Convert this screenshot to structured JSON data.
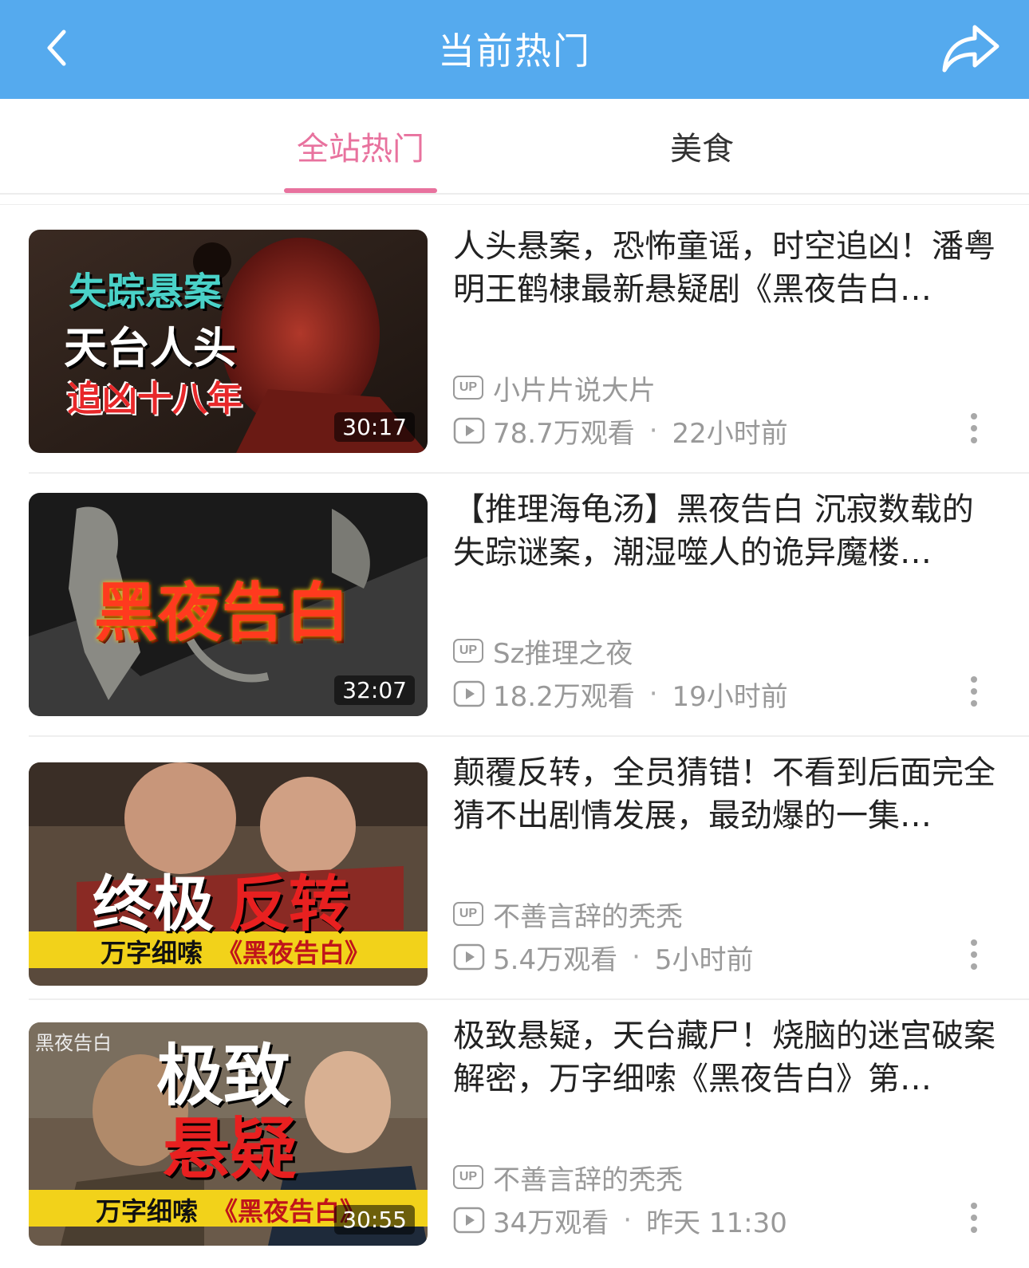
{
  "header": {
    "title": "当前热门",
    "back_icon": "chevron-left-icon",
    "share_icon": "share-icon",
    "bg_color": "#55aaee"
  },
  "tabs": [
    {
      "label": "全站热门",
      "active": true
    },
    {
      "label": "美食",
      "active": false
    }
  ],
  "accent_color": "#e8729e",
  "videos": [
    {
      "title": "人头悬案，恐怖童谣，时空追凶！潘粤明王鹤棣最新悬疑剧《黑夜告白…",
      "uploader": "小片片说大片",
      "views": "78.7万观看",
      "time": "22小时前",
      "duration": "30:17",
      "thumb_text": [
        "失踪悬案",
        "天台人头",
        "追凶十八年"
      ]
    },
    {
      "title": "【推理海龟汤】黑夜告白  沉寂数载的失踪谜案，潮湿噬人的诡异魔楼…",
      "uploader": "Sz推理之夜",
      "views": "18.2万观看",
      "time": "19小时前",
      "duration": "32:07",
      "thumb_text": [
        "黑夜告白"
      ]
    },
    {
      "title": "颠覆反转，全员猜错！不看到后面完全猜不出剧情发展，最劲爆的一集…",
      "uploader": "不善言辞的秃秃",
      "views": "5.4万观看",
      "time": "5小时前",
      "duration": "",
      "thumb_text": [
        "终极",
        "反转",
        "万字细嗦",
        "《黑夜告白》"
      ]
    },
    {
      "title": "极致悬疑，天台藏尸！烧脑的迷宫破案解密，万字细嗦《黑夜告白》第…",
      "uploader": "不善言辞的秃秃",
      "views": "34万观看",
      "time": "昨天 11:30",
      "duration": "30:55",
      "thumb_text": [
        "极致",
        "悬疑",
        "万字细嗦",
        "《黑夜告白》",
        "黑夜告白"
      ]
    }
  ],
  "icons": {
    "up_badge": "UP",
    "play": "play-icon",
    "more": "more-vertical-icon"
  }
}
